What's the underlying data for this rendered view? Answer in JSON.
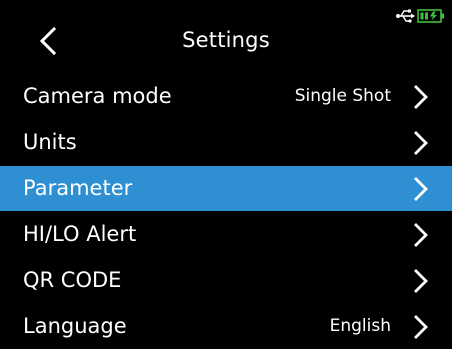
{
  "header": {
    "title": "Settings",
    "back_icon": "chevron-left-icon",
    "usb_icon": "usb-icon",
    "battery_icon": "battery-charging-icon",
    "battery_color": "#3fbf3f"
  },
  "menu": {
    "selected_color": "#2e8fd3",
    "items": [
      {
        "label": "Camera mode",
        "value": "Single Shot",
        "icon": "chevron-right-icon"
      },
      {
        "label": "Units",
        "value": "",
        "icon": "chevron-right-icon"
      },
      {
        "label": "Parameter",
        "value": "",
        "icon": "chevron-right-icon",
        "selected": true
      },
      {
        "label": "HI/LO Alert",
        "value": "",
        "icon": "chevron-right-icon"
      },
      {
        "label": "QR CODE",
        "value": "",
        "icon": "chevron-right-icon"
      },
      {
        "label": "Language",
        "value": "English",
        "icon": "chevron-right-icon"
      }
    ]
  }
}
